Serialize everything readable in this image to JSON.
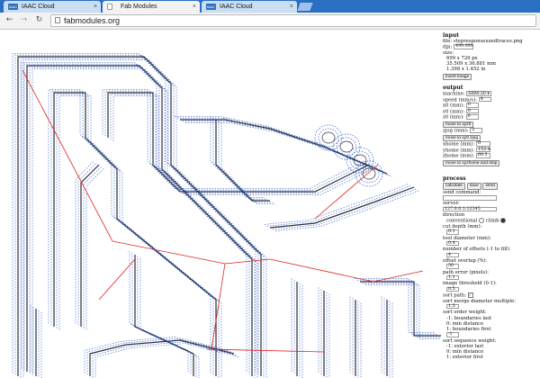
{
  "browser": {
    "tabs": [
      {
        "title": "IAAC Cloud",
        "favicon": "iaac-cloud-icon",
        "active": false
      },
      {
        "title": "Fab Modules",
        "favicon": "document-icon",
        "active": true
      },
      {
        "title": "IAAC Cloud",
        "favicon": "iaac-cloud-icon",
        "active": false
      }
    ],
    "favicon_text": "IAAC",
    "close_glyph": "×",
    "back_glyph": "←",
    "forward_glyph": "→",
    "reload_glyph": "↻",
    "url": "fabmodules.org"
  },
  "colors": {
    "tabbar": "#2a6fc4",
    "trace": "#2b2b3a",
    "toolpath": "#2c5cc8",
    "move": "#e02020"
  },
  "panel": {
    "input": {
      "heading": "input",
      "file": "file: stepresponseuzedtraces.png",
      "dpi_label": "dpi:",
      "dpi_value": "499.999",
      "size_label": "size:",
      "size_px": "699 x 726 px",
      "size_mm": "35.509 x 36.881 mm",
      "size_in": "1.398 x 1.452 in",
      "invert_button": "invert image"
    },
    "output": {
      "heading": "output",
      "machine_label": "machine:",
      "machine_value": "SRM-20",
      "speed_label": "speed (mm/s):",
      "speed_value": "4",
      "x0_label": "x0 (mm):",
      "x0_value": "0",
      "y0_label": "y0 (mm):",
      "y0_value": "0",
      "z0_label": "z0 (mm):",
      "z0_value": "0",
      "move_xyz0_button": "move to xyz0",
      "zjog_label": "zjog (mm):",
      "zjog_value": "2",
      "move_xy0_zjog_button": "move to xy0 zjog",
      "xhome_label": "xhome (mm):",
      "xhome_value": "0",
      "yhome_label": "yhome (mm):",
      "yhome_value": "152.4",
      "zhome_label": "zhome (mm):",
      "zhome_value": "60.5",
      "move_home_button": "move to xyzhome and stop"
    },
    "process": {
      "heading": "process",
      "calculate_button": "calculate",
      "save_button": "save",
      "send_button": "send",
      "send_command_label": "send command:",
      "send_command_value": "",
      "server_label": "server:",
      "server_value": "127.0.0.1:12345",
      "direction_label": "direction",
      "conventional_label": "conventional",
      "climb_label": "climb",
      "cut_depth_label": "cut depth (mm):",
      "cut_depth_value": "0.1",
      "tool_diameter_label": "tool diameter (mm):",
      "tool_diameter_value": "0.4",
      "offsets_label": "number of offsets (-1 to fill):",
      "offsets_value": "4",
      "overlap_label": "offset overlap (%):",
      "overlap_value": "50",
      "path_error_label": "path error (pixels):",
      "path_error_value": "1.1",
      "threshold_label": "image threshold (0-1):",
      "threshold_value": "0.5",
      "sort_path_label": "sort path:",
      "merge_label": "sort merge diameter multiple:",
      "merge_value": "1.5",
      "order_label": "sort order weight:",
      "order_items": [
        "-1: boundaries last",
        "0: min distance",
        "1: boundaries first"
      ],
      "order_value": "-1",
      "sequence_label": "sort sequence weight:",
      "sequence_items": [
        "-1: exterior last",
        "0: min distance",
        "1: exterior first"
      ],
      "sequence_value": "-1"
    }
  }
}
